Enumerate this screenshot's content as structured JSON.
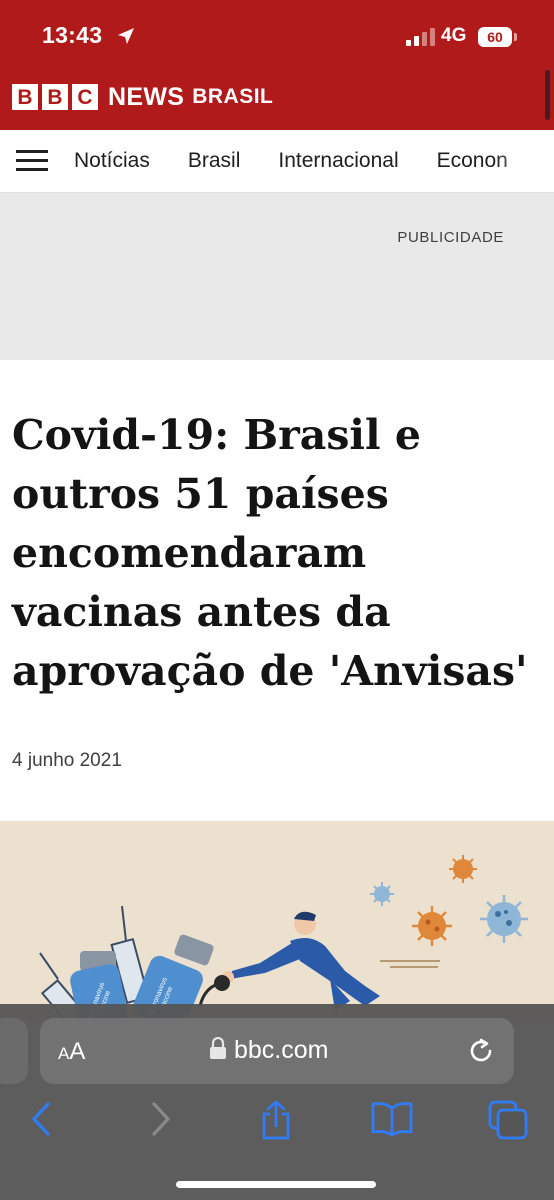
{
  "status_bar": {
    "time": "13:43",
    "network": "4G",
    "battery": "60",
    "icons": [
      "location-arrow-icon",
      "signal-bars-icon",
      "battery-icon"
    ]
  },
  "brand": {
    "letters": [
      "B",
      "B",
      "C"
    ],
    "news": "NEWS",
    "region": "BRASIL"
  },
  "nav": {
    "menu_icon": "hamburger-menu-icon",
    "items": [
      {
        "label": "Notícias"
      },
      {
        "label": "Brasil"
      },
      {
        "label": "Internacional"
      },
      {
        "label": "Econon"
      }
    ]
  },
  "ad": {
    "label": "PUBLICIDADE"
  },
  "article": {
    "headline": "Covid-19: Brasil e outros 51 países encomendaram vacinas antes da aprovação de 'Anvisas'",
    "date": "4 junho 2021",
    "image_texts": {
      "vial_left_line1": "Coronavirus",
      "vial_left_line2": "Vaccine",
      "vial_right_line1": "Coronavirus",
      "vial_right_line2": "Vaccine"
    }
  },
  "browser": {
    "text_size_big": "A",
    "text_size_small": "A",
    "url": "bbc.com",
    "toolbar_icons": [
      "back-icon",
      "forward-icon",
      "share-icon",
      "bookmarks-icon",
      "tabs-icon"
    ]
  },
  "colors": {
    "bbc_red": "#b01a1a",
    "illustration_bg": "#ece1cf",
    "browser_chrome": "#565656",
    "link_blue": "#2f7cf6"
  }
}
